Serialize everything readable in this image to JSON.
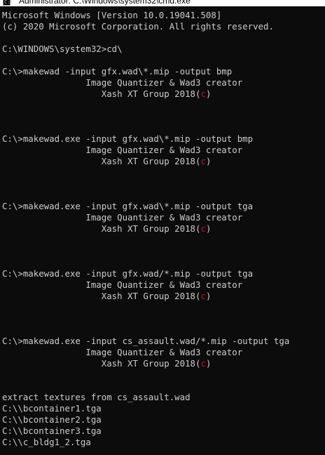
{
  "window": {
    "title": "Administrator: C:\\Windows\\system32\\cmd.exe",
    "icon": "cmd-icon",
    "text_color": "#cccccc",
    "background_color": "#0c0c0c",
    "accent_color": "#c50f1f"
  },
  "console": {
    "lines": [
      {
        "text": "Microsoft Windows [Version 10.0.19041.508]"
      },
      {
        "text": "(c) 2020 Microsoft Corporation. All rights reserved."
      },
      {
        "text": ""
      },
      {
        "text": "C:\\WINDOWS\\system32>cd\\"
      },
      {
        "text": ""
      },
      {
        "text": "C:\\>makewad -input gfx.wad\\*.mip -output bmp"
      },
      {
        "text": "                Image Quantizer & Wad3 creator"
      },
      {
        "text": "                   Xash XT Group 2018(",
        "red": "c",
        "after": ")"
      },
      {
        "text": ""
      },
      {
        "text": ""
      },
      {
        "text": ""
      },
      {
        "text": "C:\\>makewad.exe -input gfx.wad\\*.mip -output bmp"
      },
      {
        "text": "                Image Quantizer & Wad3 creator"
      },
      {
        "text": "                   Xash XT Group 2018(",
        "red": "c",
        "after": ")"
      },
      {
        "text": ""
      },
      {
        "text": ""
      },
      {
        "text": ""
      },
      {
        "text": "C:\\>makewad.exe -input gfx.wad\\*.mip -output tga"
      },
      {
        "text": "                Image Quantizer & Wad3 creator"
      },
      {
        "text": "                   Xash XT Group 2018(",
        "red": "c",
        "after": ")"
      },
      {
        "text": ""
      },
      {
        "text": ""
      },
      {
        "text": ""
      },
      {
        "text": "C:\\>makewad.exe -input gfx.wad/*.mip -output tga"
      },
      {
        "text": "                Image Quantizer & Wad3 creator"
      },
      {
        "text": "                   Xash XT Group 2018(",
        "red": "c",
        "after": ")"
      },
      {
        "text": ""
      },
      {
        "text": ""
      },
      {
        "text": ""
      },
      {
        "text": "C:\\>makewad.exe -input cs_assault.wad/*.mip -output tga"
      },
      {
        "text": "                Image Quantizer & Wad3 creator"
      },
      {
        "text": "                   Xash XT Group 2018(",
        "red": "c",
        "after": ")"
      },
      {
        "text": ""
      },
      {
        "text": ""
      },
      {
        "text": "extract textures from cs_assault.wad"
      },
      {
        "text": "C:\\\\bcontainer1.tga"
      },
      {
        "text": "C:\\\\bcontainer2.tga"
      },
      {
        "text": "C:\\\\bcontainer3.tga"
      },
      {
        "text": "C:\\\\c_bldg1_2.tga"
      }
    ]
  }
}
